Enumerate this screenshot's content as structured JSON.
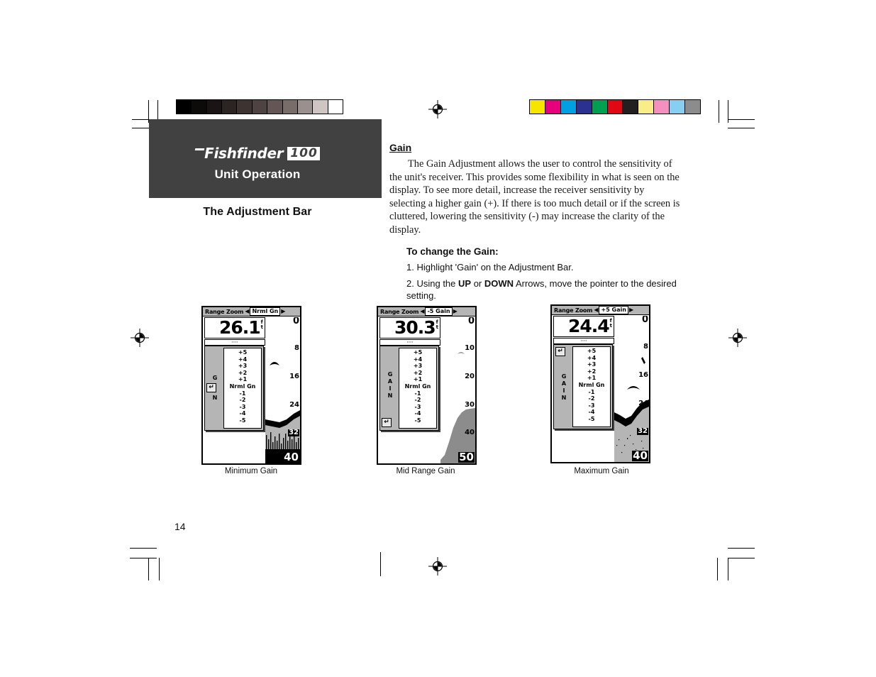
{
  "document": {
    "page_number": "14",
    "header_panel": {
      "logo_word": "Fishfinder",
      "logo_number": "100",
      "panel_title": "Unit Operation"
    },
    "section_title": "The Adjustment Bar"
  },
  "content": {
    "heading": "Gain",
    "paragraph": "The Gain Adjustment allows the user to control the sensitivity of the unit's receiver.  This provides some flexibility in what is seen on the display. To see more detail, increase the receiver sensitivity by selecting a higher gain (+). If there is too much detail or if the screen is cluttered, lowering the sensitivity (-) may increase the clarity of the display.",
    "subheading": "To change the Gain:",
    "steps": [
      {
        "number": "1.",
        "text": "Highlight 'Gain' on the Adjustment Bar."
      },
      {
        "number": "2.",
        "prefix": "Using the ",
        "bold1": "UP",
        "mid": " or ",
        "bold2": "DOWN",
        "suffix": " Arrows, move the pointer to the desired setting."
      }
    ]
  },
  "gain_menu": {
    "items": [
      "+5",
      "+4",
      "+3",
      "+2",
      "+1",
      "Nrml Gn",
      "-1",
      "-2",
      "-3",
      "-4",
      "-5"
    ],
    "pointer_glyph": "↵"
  },
  "screenshots": [
    {
      "caption": "Minimum Gain",
      "header_label": "Range Zoom",
      "header_selection": "Nrml Gn",
      "left_arrow": "◀",
      "right_arrow": "▶",
      "depth_value": "26.1",
      "depth_unit_top": "f",
      "depth_unit_bottom": "t",
      "temp_strip": "····",
      "side_label": [
        "G",
        "N"
      ],
      "pointer_index": 5,
      "depth_scale": [
        "0",
        "8",
        "16",
        "24",
        "32"
      ],
      "bottom_scale": "40"
    },
    {
      "caption": "Mid Range Gain",
      "header_label": "Range Zoom",
      "header_selection": "-5 Gain",
      "left_arrow": "◀",
      "right_arrow": "▶",
      "depth_value": "30.3",
      "depth_unit_top": "f",
      "depth_unit_bottom": "t",
      "temp_strip": "····",
      "side_label": [
        "G",
        "A",
        "I",
        "N"
      ],
      "pointer_index": 10,
      "depth_scale": [
        "0",
        "10",
        "20",
        "30",
        "40"
      ],
      "bottom_scale": "50"
    },
    {
      "caption": "Maximum Gain",
      "header_label": "Range Zoom",
      "header_selection": "+5 Gain",
      "left_arrow": "◀",
      "right_arrow": "▶",
      "depth_value": "24.4",
      "depth_unit_top": "f",
      "depth_unit_bottom": "t",
      "temp_strip": "····",
      "side_label": [
        "G",
        "A",
        "I",
        "N"
      ],
      "pointer_index": 0,
      "depth_scale": [
        "0",
        "8",
        "16",
        "24",
        "32"
      ],
      "bottom_scale": "40"
    }
  ],
  "print_marks": {
    "grayscale_swatches": [
      "#000000",
      "#0d0a0a",
      "#1a1514",
      "#2b2422",
      "#3d3431",
      "#4e4340",
      "#635654",
      "#796d6a",
      "#9a908d",
      "#cfc6c3",
      "#ffffff"
    ],
    "color_swatches": [
      "#f7e500",
      "#e6007e",
      "#00a0e3",
      "#2b3190",
      "#00a052",
      "#e30613",
      "#231f20",
      "#fbec8a",
      "#f490c0",
      "#86cff2",
      "#8c8c8c"
    ]
  }
}
